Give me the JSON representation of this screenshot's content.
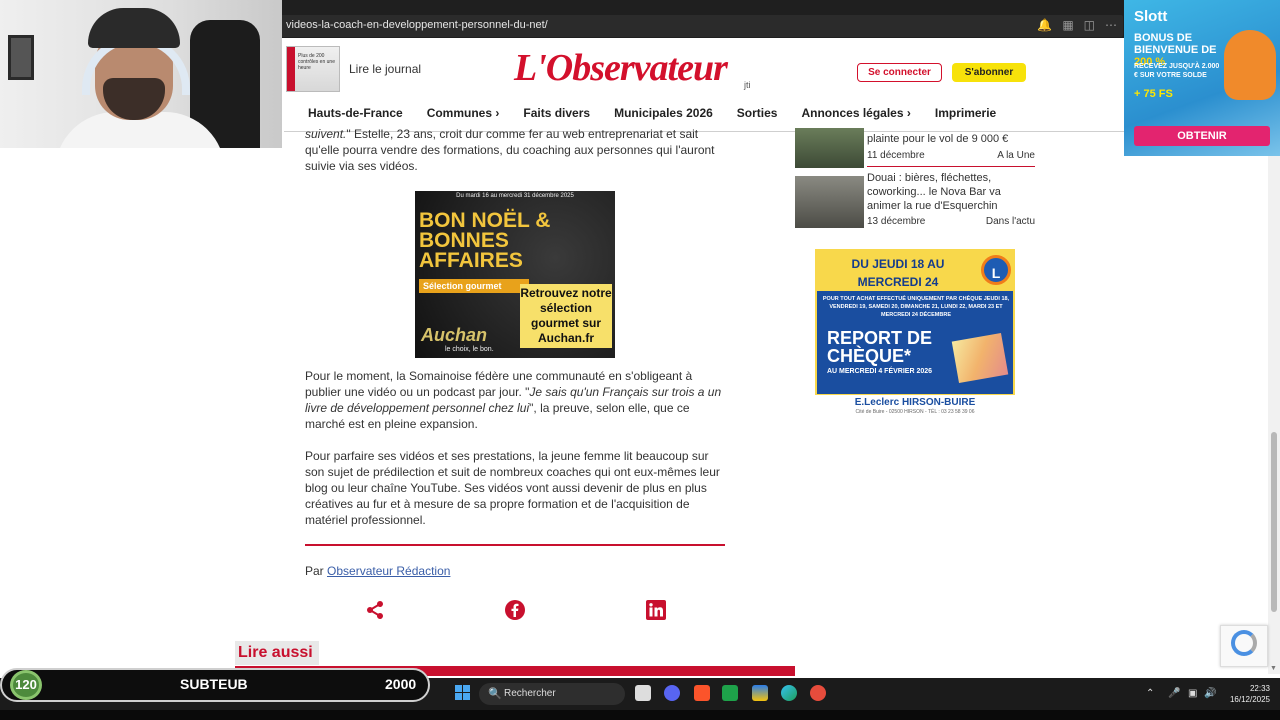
{
  "browser": {
    "url": "videos-la-coach-en-developpement-personnel-du-net/"
  },
  "header": {
    "lire_journal": "Lire le journal",
    "journal_thumb_text": "Plus de 200 contrôles en une heure",
    "logo": "L'Observateur",
    "logo_badge": "jti",
    "connect": "Se connecter",
    "subscribe": "S'abonner",
    "nav": [
      "Hauts-de-France",
      "Communes ›",
      "Faits divers",
      "Municipales 2026",
      "Sorties",
      "Annonces légales ›",
      "Imprimerie"
    ]
  },
  "slott_ad": {
    "brand": "Slott",
    "bonus_line1": "BONUS DE BIENVENUE DE",
    "bonus_pct": "200 %",
    "small": "RECEVEZ JUSQU'À 2.000 € SUR VOTRE SOLDE",
    "fs": "+ 75 FS",
    "cta": "OBTENIR"
  },
  "article": {
    "p1_italic": "suivent.",
    "p1_rest": "\" Estelle, 23 ans, croit dur comme fer au web entreprenariat et sait qu'elle pourra vendre des formations, du coaching aux personnes qui l'auront suivie via ses vidéos.",
    "p2_a": "Pour le moment, la Somainoise fédère une communauté en s'obligeant à publier une vidéo ou un podcast par jour. \"",
    "p2_italic": "Je sais qu'un Français sur trois a un livre de développement personnel chez lui",
    "p2_b": "\", la preuve, selon elle, que ce marché est en pleine expansion.",
    "p3": "Pour parfaire ses vidéos et ses prestations, la jeune femme lit beaucoup sur son sujet de prédilection et suit de nombreux coaches qui ont eux-mêmes leur blog ou leur chaîne YouTube. Ses vidéos vont aussi devenir de plus en plus créatives au fur et à mesure de sa propre formation et de l'acquisition de matériel professionnel.",
    "byline_prefix": "Par ",
    "byline_author": "Observateur Rédaction",
    "lire_aussi": "Lire aussi"
  },
  "auchan_ad": {
    "date": "Du mardi 16 au mercredi 31 décembre 2025",
    "title": "BON NOËL & BONNES AFFAIRES",
    "tag": "Sélection gourmet",
    "retrouvez": "Retrouvez notre sélection gourmet sur Auchan.fr",
    "brand": "Auchan",
    "brand_sub": "le choix, le bon."
  },
  "sidebar": {
    "items": [
      {
        "title": "plainte pour le vol de 9 000 €",
        "date": "11 décembre",
        "category": "A la Une"
      },
      {
        "title": "Douai : bières, fléchettes, coworking... le Nova Bar va animer la rue d'Esquerchin",
        "date": "13 décembre",
        "category": "Dans l'actu"
      }
    ]
  },
  "leclerc_ad": {
    "headline": "DU JEUDI 18 AU MERCREDI 24 DÉCEMBRE 2025",
    "logo": "L",
    "conditions": "POUR TOUT ACHAT EFFECTUÉ UNIQUEMENT PAR CHÈQUE JEUDI 18, VENDREDI 19, SAMEDI 20, DIMANCHE 21, LUNDI 22, MARDI 23 ET MERCREDI 24 DÉCEMBRE",
    "report": "REPORT DE CHÈQUE*",
    "report_date": "AU MERCREDI 4 FÉVRIER 2026",
    "store": "E.Leclerc HIRSON-BUIRE",
    "store_addr": "Cité de Buire - 02500 HIRSON - TÉL : 03 23 58 39 06"
  },
  "stream": {
    "count": "120",
    "label": "SUBTEUB",
    "goal": "2000"
  },
  "taskbar": {
    "search_placeholder": "Rechercher",
    "time": "22:33",
    "date": "16/12/2025"
  }
}
